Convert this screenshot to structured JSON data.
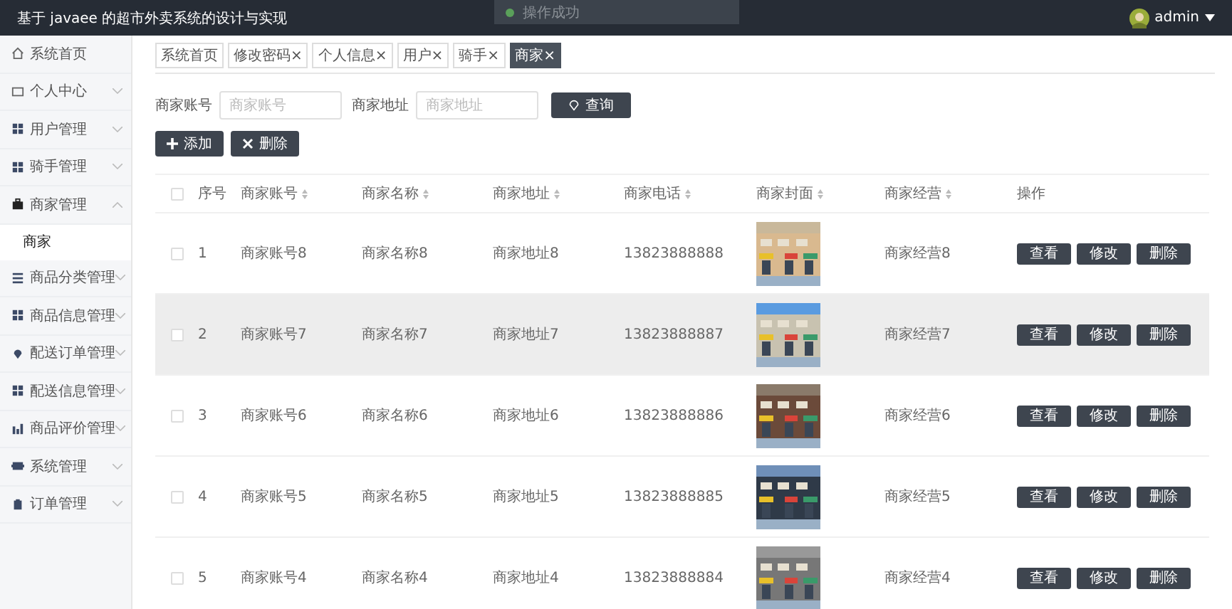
{
  "header": {
    "title": "基于 javaee 的超市外卖系统的设计与实现",
    "user": "admin"
  },
  "toast": {
    "text": "操作成功"
  },
  "sidebar": {
    "items": [
      {
        "label": "系统首页"
      },
      {
        "label": "个人中心",
        "expanded": false
      },
      {
        "label": "用户管理",
        "expanded": false
      },
      {
        "label": "骑手管理",
        "expanded": false
      },
      {
        "label": "商家管理",
        "expanded": true,
        "children": [
          {
            "label": "商家",
            "selected": true
          }
        ]
      },
      {
        "label": "商品分类管理",
        "expanded": false
      },
      {
        "label": "商品信息管理",
        "expanded": false
      },
      {
        "label": "配送订单管理",
        "expanded": false
      },
      {
        "label": "配送信息管理",
        "expanded": false
      },
      {
        "label": "商品评价管理",
        "expanded": false
      },
      {
        "label": "系统管理",
        "expanded": false
      },
      {
        "label": "订单管理",
        "expanded": false
      }
    ]
  },
  "tabs": [
    {
      "label": "系统首页",
      "selected": false
    },
    {
      "label": "修改密码×",
      "selected": false
    },
    {
      "label": "个人信息×",
      "selected": false
    },
    {
      "label": "用户×",
      "selected": false
    },
    {
      "label": "骑手×",
      "selected": false
    },
    {
      "label": "商家×",
      "selected": true
    }
  ],
  "search": {
    "fields": [
      {
        "label": "商家账号",
        "placeholder": "商家账号"
      },
      {
        "label": "商家地址",
        "placeholder": "商家地址"
      }
    ],
    "button": "查询"
  },
  "actions": [
    {
      "kind": "add",
      "label": "添加"
    },
    {
      "kind": "delete",
      "label": "删除"
    }
  ],
  "table": {
    "columns": [
      {
        "label": "序号",
        "sortable": false
      },
      {
        "label": "商家账号",
        "sortable": true
      },
      {
        "label": "商家名称",
        "sortable": true
      },
      {
        "label": "商家地址",
        "sortable": true
      },
      {
        "label": "商家电话",
        "sortable": true
      },
      {
        "label": "商家封面",
        "sortable": true
      },
      {
        "label": "商家经营",
        "sortable": true
      },
      {
        "label": "操作",
        "sortable": false
      }
    ],
    "select_all_checked": false,
    "rows": [
      {
        "checked": false,
        "index": "1",
        "account": "商家账号8",
        "name": "商家名称8",
        "address": "商家地址8",
        "phone": "13823888888",
        "business": "商家经营8",
        "hovered": false,
        "buttons": [
          "查看",
          "修改",
          "删除"
        ]
      },
      {
        "checked": false,
        "index": "2",
        "account": "商家账号7",
        "name": "商家名称7",
        "address": "商家地址7",
        "phone": "13823888887",
        "business": "商家经营7",
        "hovered": true,
        "buttons": [
          "查看",
          "修改",
          "删除"
        ]
      },
      {
        "checked": false,
        "index": "3",
        "account": "商家账号6",
        "name": "商家名称6",
        "address": "商家地址6",
        "phone": "13823888886",
        "business": "商家经营6",
        "hovered": false,
        "buttons": [
          "查看",
          "修改",
          "删除"
        ]
      },
      {
        "checked": false,
        "index": "4",
        "account": "商家账号5",
        "name": "商家名称5",
        "address": "商家地址5",
        "phone": "13823888885",
        "business": "商家经营5",
        "hovered": false,
        "buttons": [
          "查看",
          "修改",
          "删除"
        ]
      },
      {
        "checked": false,
        "index": "5",
        "account": "商家账号4",
        "name": "商家名称4",
        "address": "商家地址4",
        "phone": "13823888884",
        "business": "商家经营4",
        "hovered": false,
        "buttons": [
          "查看",
          "修改",
          "删除"
        ]
      }
    ]
  }
}
